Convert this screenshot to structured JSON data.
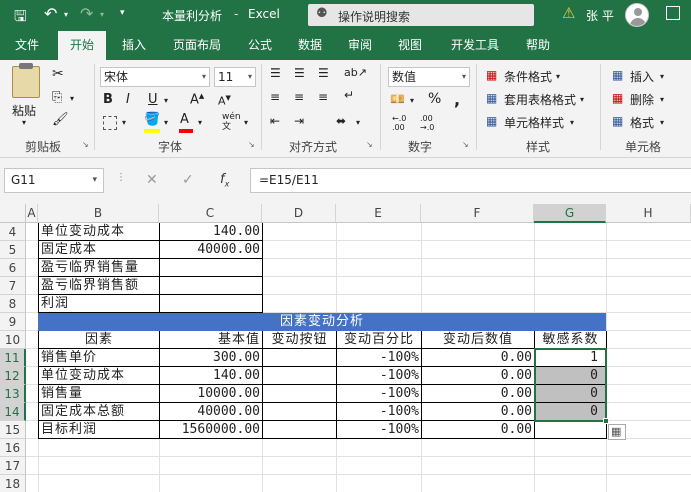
{
  "titlebar": {
    "doc_title": "本量利分析",
    "sep": "-",
    "app_name": "Excel",
    "search_placeholder": "操作说明搜索",
    "user_name": "张 平"
  },
  "tabs": [
    "文件",
    "开始",
    "插入",
    "页面布局",
    "公式",
    "数据",
    "审阅",
    "视图",
    "开发工具",
    "帮助"
  ],
  "ribbon": {
    "clipboard": {
      "paste_label": "粘贴",
      "group_label": "剪贴板"
    },
    "font": {
      "font_name": "宋体",
      "font_size": "11",
      "group_label": "字体"
    },
    "alignment": {
      "group_label": "对齐方式"
    },
    "number": {
      "format": "数值",
      "group_label": "数字"
    },
    "styles": {
      "conditional": "条件格式",
      "table": "套用表格格式",
      "cell": "单元格样式",
      "group_label": "样式"
    },
    "cells": {
      "insert": "插入",
      "delete": "删除",
      "format": "格式",
      "group_label": "单元格"
    }
  },
  "formula_bar": {
    "name_box": "G11",
    "formula": "=E15/E11"
  },
  "columns": [
    "A",
    "B",
    "C",
    "D",
    "E",
    "F",
    "G",
    "H"
  ],
  "rows": [
    "4",
    "5",
    "6",
    "7",
    "8",
    "9",
    "10",
    "11",
    "12",
    "13",
    "14",
    "15",
    "16",
    "17",
    "18"
  ],
  "cells": {
    "r4": {
      "b": "单位变动成本",
      "c": "140.00"
    },
    "r5": {
      "b": "固定成本",
      "c": "40000.00"
    },
    "r6": {
      "b": "盈亏临界销售量"
    },
    "r7": {
      "b": "盈亏临界销售额"
    },
    "r8": {
      "b": "利润"
    },
    "r9": {
      "title": "因素变动分析"
    },
    "r10": {
      "b": "因素",
      "c": "基本值",
      "d": "变动按钮",
      "e": "变动百分比",
      "f": "变动后数值",
      "g": "敏感系数"
    },
    "r11": {
      "b": "销售单价",
      "c": "300.00",
      "e": "-100%",
      "f": "0.00",
      "g": "1"
    },
    "r12": {
      "b": "单位变动成本",
      "c": "140.00",
      "e": "-100%",
      "f": "0.00",
      "g": "0"
    },
    "r13": {
      "b": "销售量",
      "c": "10000.00",
      "e": "-100%",
      "f": "0.00",
      "g": "0"
    },
    "r14": {
      "b": "固定成本总额",
      "c": "40000.00",
      "e": "-100%",
      "f": "0.00",
      "g": "0"
    },
    "r15": {
      "b": "目标利润",
      "c": "1560000.00",
      "e": "-100%",
      "f": "0.00"
    }
  },
  "colors": {
    "excel_green": "#217346",
    "header_blue": "#4472c4",
    "selected_gray": "#c0c0c0"
  }
}
